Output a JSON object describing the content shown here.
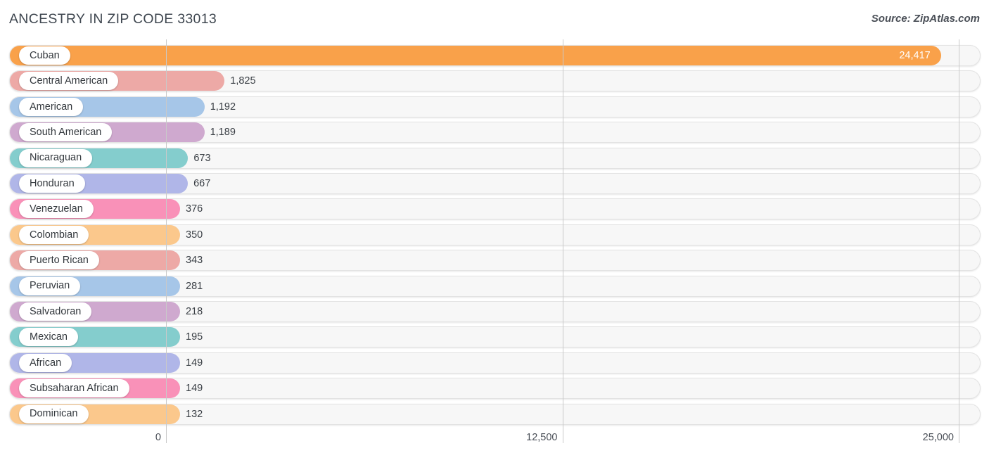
{
  "header": {
    "title": "ANCESTRY IN ZIP CODE 33013",
    "source": "Source: ZipAtlas.com"
  },
  "axis": {
    "ticks": [
      "0",
      "12,500",
      "25,000"
    ],
    "min": 0,
    "max": 25000
  },
  "chart_data": {
    "type": "bar",
    "orientation": "horizontal",
    "title": "ANCESTRY IN ZIP CODE 33013",
    "xlabel": "",
    "ylabel": "",
    "xlim": [
      0,
      25000
    ],
    "grid": true,
    "legend": "none",
    "categories": [
      "Cuban",
      "Central American",
      "American",
      "South American",
      "Nicaraguan",
      "Honduran",
      "Venezuelan",
      "Colombian",
      "Puerto Rican",
      "Peruvian",
      "Salvadoran",
      "Mexican",
      "African",
      "Subsaharan African",
      "Dominican"
    ],
    "values": [
      24417,
      1825,
      1192,
      1189,
      673,
      667,
      376,
      350,
      343,
      281,
      218,
      195,
      149,
      149,
      132
    ],
    "value_labels": [
      "24,417",
      "1,825",
      "1,192",
      "1,189",
      "673",
      "667",
      "376",
      "350",
      "343",
      "281",
      "218",
      "195",
      "149",
      "149",
      "132"
    ],
    "colors": [
      "#f9a council",
      "#eda9a6",
      "#a6c6e8",
      "#cfa9cf",
      "#84cdcd",
      "#b0b6e8",
      "#f991b8",
      "#fbc88c",
      "#eda9a6",
      "#a6c6e8",
      "#cfa9cf",
      "#84cdcd",
      "#b0b6e8",
      "#f991b8",
      "#fbc88c"
    ]
  },
  "bars": [
    {
      "label": "Cuban",
      "value_label": "24,417",
      "value": 24417,
      "color": "#f9a css",
      "inside": true
    },
    {
      "label": "Central American",
      "value_label": "1,825",
      "value": 1825,
      "color": "#eda9a6",
      "inside": false
    },
    {
      "label": "American",
      "value_label": "1,192",
      "value": 1192,
      "color": "#a6c6e8",
      "inside": false
    },
    {
      "label": "South American",
      "value_label": "1,189",
      "value": 1189,
      "color": "#cfa9cf",
      "inside": false
    },
    {
      "label": "Nicaraguan",
      "value_label": "673",
      "value": 673,
      "color": "#84cdcd",
      "inside": false
    },
    {
      "label": "Honduran",
      "value_label": "667",
      "value": 667,
      "color": "#b0b6e8",
      "inside": false
    },
    {
      "label": "Venezuelan",
      "value_label": "376",
      "value": 376,
      "color": "#f991b8",
      "inside": false
    },
    {
      "label": "Colombian",
      "value_label": "350",
      "value": 350,
      "color": "#fbc88c",
      "inside": false
    },
    {
      "label": "Puerto Rican",
      "value_label": "343",
      "value": 343,
      "color": "#eda9a6",
      "inside": false
    },
    {
      "label": "Peruvian",
      "value_label": "281",
      "value": 281,
      "color": "#a6c6e8",
      "inside": false
    },
    {
      "label": "Salvadoran",
      "value_label": "218",
      "value": 218,
      "color": "#cfa9cf",
      "inside": false
    },
    {
      "label": "Mexican",
      "value_label": "195",
      "value": 195,
      "color": "#84cdcd",
      "inside": false
    },
    {
      "label": "African",
      "value_label": "149",
      "value": 149,
      "color": "#b0b6e8",
      "inside": false
    },
    {
      "label": "Subsaharan African",
      "value_label": "149",
      "value": 149,
      "color": "#f991b8",
      "inside": false
    },
    {
      "label": "Dominican",
      "value_label": "132",
      "value": 132,
      "color": "#fbc88c",
      "inside": false
    }
  ]
}
